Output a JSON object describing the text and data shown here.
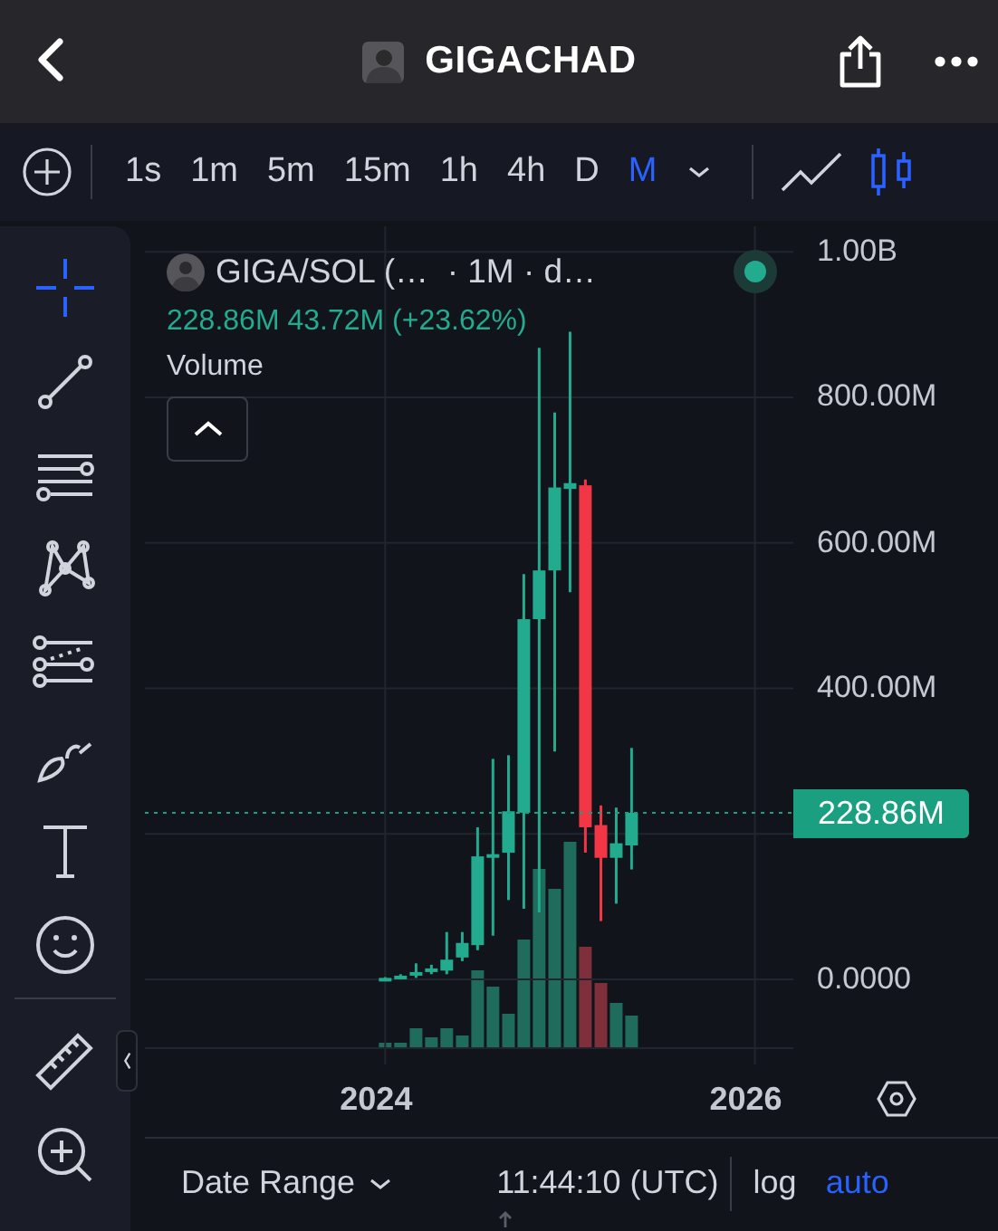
{
  "header": {
    "title": "GIGACHAD"
  },
  "intervals": [
    {
      "label": "1s",
      "selected": false
    },
    {
      "label": "1m",
      "selected": false
    },
    {
      "label": "5m",
      "selected": false
    },
    {
      "label": "15m",
      "selected": false
    },
    {
      "label": "1h",
      "selected": false
    },
    {
      "label": "4h",
      "selected": false
    },
    {
      "label": "D",
      "selected": false
    },
    {
      "label": "M",
      "selected": true
    }
  ],
  "chart_types": [
    {
      "kind": "line",
      "selected": false
    },
    {
      "kind": "candles",
      "selected": true
    }
  ],
  "tools": [
    {
      "kind": "crosshair",
      "selected": true
    },
    {
      "kind": "trend-line",
      "selected": false
    },
    {
      "kind": "lines",
      "selected": false
    },
    {
      "kind": "pattern",
      "selected": false
    },
    {
      "kind": "fib",
      "selected": false
    },
    {
      "kind": "brush",
      "selected": false
    },
    {
      "kind": "text",
      "selected": false
    },
    {
      "kind": "emoji",
      "selected": false
    }
  ],
  "measure_tools": [
    {
      "kind": "ruler",
      "selected": false
    },
    {
      "kind": "zoom",
      "selected": false
    }
  ],
  "legend": {
    "symbol": "GIGA/SOL (…",
    "interval": "· 1M · d…",
    "live": true,
    "values": "228.86M 43.72M (+23.62%)",
    "indicator": "Volume"
  },
  "chart": {
    "chart_data": {
      "type": "candlestick",
      "x": [
        2024,
        2024.083,
        2024.167,
        2024.25,
        2024.333,
        2024.417,
        2024.5,
        2024.583,
        2024.667,
        2024.75,
        2024.833,
        2024.917,
        2025,
        2025.083,
        2025.167,
        2025.25,
        2025.333
      ],
      "ohlc": [
        [
          1000000,
          3000000,
          0,
          2000000
        ],
        [
          2000000,
          7000000,
          0,
          5000000
        ],
        [
          5000000,
          22000000,
          2000000,
          10000000
        ],
        [
          10000000,
          20000000,
          7000000,
          15000000
        ],
        [
          12000000,
          65000000,
          7000000,
          27000000
        ],
        [
          30000000,
          65000000,
          25000000,
          50000000
        ],
        [
          47000000,
          209000000,
          40000000,
          169000000
        ],
        [
          167000000,
          303000000,
          60000000,
          172000000
        ],
        [
          174000000,
          308000000,
          109000000,
          231000000
        ],
        [
          229000000,
          557000000,
          97000000,
          495000000
        ],
        [
          495000000,
          868000000,
          92000000,
          562000000
        ],
        [
          562000000,
          779000000,
          313000000,
          676000000
        ],
        [
          674000000,
          890000000,
          532000000,
          682000000
        ],
        [
          679000000,
          687000000,
          174000000,
          209000000
        ],
        [
          212000000,
          239000000,
          80000000,
          167000000
        ],
        [
          167000000,
          236000000,
          104000000,
          187000000
        ],
        [
          184000000,
          318000000,
          151000000,
          228860000
        ]
      ],
      "xlim": [
        2022.7,
        2026.208
      ],
      "ylim": [
        -117000000,
        1035000000
      ],
      "xticks": [
        {
          "value": 2024,
          "label": "2024"
        },
        {
          "value": 2026,
          "label": "2026"
        }
      ],
      "yticks": [
        {
          "value": 1000000000,
          "label": "1.00B"
        },
        {
          "value": 800000000,
          "label": "800.00M"
        },
        {
          "value": 600000000,
          "label": "600.00M"
        },
        {
          "value": 400000000,
          "label": "400.00M"
        },
        {
          "value": 0,
          "label": "0.0000"
        }
      ],
      "grid": true,
      "ref_lines": [
        {
          "axis": "y",
          "value": 228860000,
          "label": "228.86M"
        }
      ]
    }
  },
  "bottom_bar": {
    "date_range": "Date Range",
    "time": "11:44:10 (UTC)",
    "log": {
      "label": "log",
      "on": false
    },
    "auto": {
      "label": "auto",
      "on": true
    }
  }
}
